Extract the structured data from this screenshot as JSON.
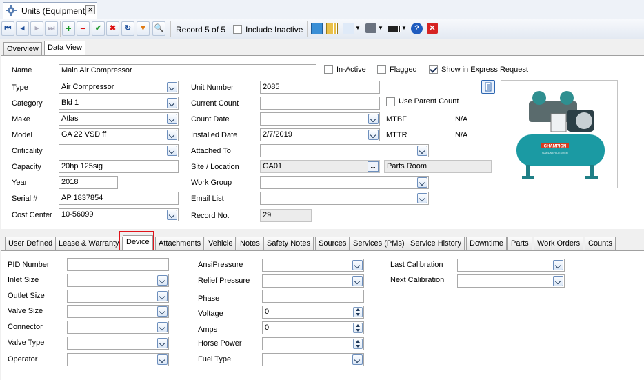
{
  "window": {
    "tab_title": "Units (Equipment)",
    "close_glyph": "×"
  },
  "toolbar": {
    "record": "Record 5 of 5",
    "include_inactive": "Include Inactive",
    "include_inactive_checked": false
  },
  "view_tabs": [
    "Overview",
    "Data View"
  ],
  "form": {
    "name_label": "Name",
    "name": "Main Air Compressor",
    "inactive_label": "In-Active",
    "flagged_label": "Flagged",
    "express_label": "Show in Express Request",
    "type_label": "Type",
    "type": "Air Compressor",
    "category_label": "Category",
    "category": "Bld 1",
    "make_label": "Make",
    "make": "Atlas",
    "model_label": "Model",
    "model": "GA 22 VSD ff",
    "criticality_label": "Criticality",
    "criticality": "",
    "capacity_label": "Capacity",
    "capacity": "20hp 125sig",
    "year_label": "Year",
    "year": "2018",
    "serial_label": "Serial #",
    "serial": "AP 1837854",
    "cost_center_label": "Cost Center",
    "cost_center": "10-56099",
    "unit_number_label": "Unit Number",
    "unit_number": "2085",
    "current_count_label": "Current Count",
    "current_count": "",
    "use_parent_label": "Use Parent Count",
    "count_date_label": "Count Date",
    "count_date": "",
    "installed_label": "Installed Date",
    "installed": "2/7/2019",
    "attached_label": "Attached To",
    "attached": "",
    "site_label": "Site / Location",
    "site": "GA01",
    "location": "Parts Room",
    "work_group_label": "Work Group",
    "work_group": "",
    "email_label": "Email List",
    "email": "",
    "record_no_label": "Record No.",
    "record_no": "29",
    "mtbf_label": "MTBF",
    "mtbf": "N/A",
    "mttr_label": "MTTR",
    "mttr": "N/A",
    "ellipsis": "..."
  },
  "photo": {
    "brand": "CHAMPION",
    "tagline": "GARDNER DENVER"
  },
  "detail_tabs": [
    "User Defined",
    "Lease & Warranty",
    "Device",
    "Attachments",
    "Vehicle",
    "Notes",
    "Safety Notes",
    "Sources",
    "Services (PMs)",
    "Service History",
    "Downtime",
    "Parts",
    "Work Orders",
    "Counts"
  ],
  "device": {
    "pid_label": "PID Number",
    "pid": "",
    "inlet_label": "Inlet Size",
    "outlet_label": "Outlet Size",
    "valve_size_label": "Valve Size",
    "connector_label": "Connector",
    "valve_type_label": "Valve Type",
    "operator_label": "Operator",
    "ansi_label": "AnsiPressure",
    "relief_label": "Relief Pressure",
    "phase_label": "Phase",
    "voltage_label": "Voltage",
    "voltage": "0",
    "amps_label": "Amps",
    "amps": "0",
    "horse_label": "Horse Power",
    "horse": "",
    "fuel_label": "Fuel Type",
    "last_cal_label": "Last Calibration",
    "next_cal_label": "Next Calibration"
  },
  "colors": {
    "highlight_box": "#e0141b",
    "header_bg": "#dde7f4"
  }
}
